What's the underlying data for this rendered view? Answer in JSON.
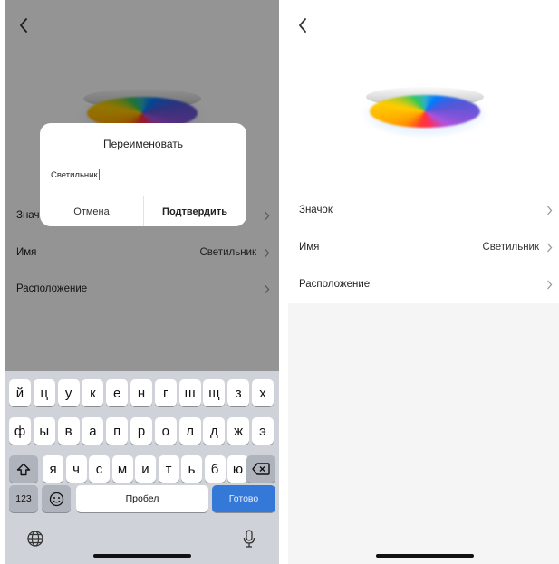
{
  "back_icon": "chevron-left-icon",
  "settings": {
    "icon_label": "Значок",
    "name_label": "Имя",
    "name_value": "Светильник",
    "location_label": "Расположение",
    "icon_label_truncated": "Знач"
  },
  "dialog": {
    "title": "Переименовать",
    "input_value": "Светильник",
    "cancel_label": "Отмена",
    "confirm_label": "Подтвердить"
  },
  "keyboard": {
    "row1": [
      "й",
      "ц",
      "у",
      "к",
      "е",
      "н",
      "г",
      "ш",
      "щ",
      "з",
      "х"
    ],
    "row2": [
      "ф",
      "ы",
      "в",
      "а",
      "п",
      "р",
      "о",
      "л",
      "д",
      "ж",
      "э"
    ],
    "row3": [
      "я",
      "ч",
      "с",
      "м",
      "и",
      "т",
      "ь",
      "б",
      "ю"
    ],
    "numbers_label": "123",
    "space_label": "Пробел",
    "return_label": "Готово",
    "shift_icon": "shift-icon",
    "delete_icon": "backspace-icon",
    "emoji_icon": "emoji-icon",
    "globe_icon": "globe-icon",
    "mic_icon": "microphone-icon"
  },
  "colors": {
    "accent_blue": "#3478d8",
    "keyboard_bg": "#cfd2d8",
    "caret": "#2a6cf0"
  }
}
